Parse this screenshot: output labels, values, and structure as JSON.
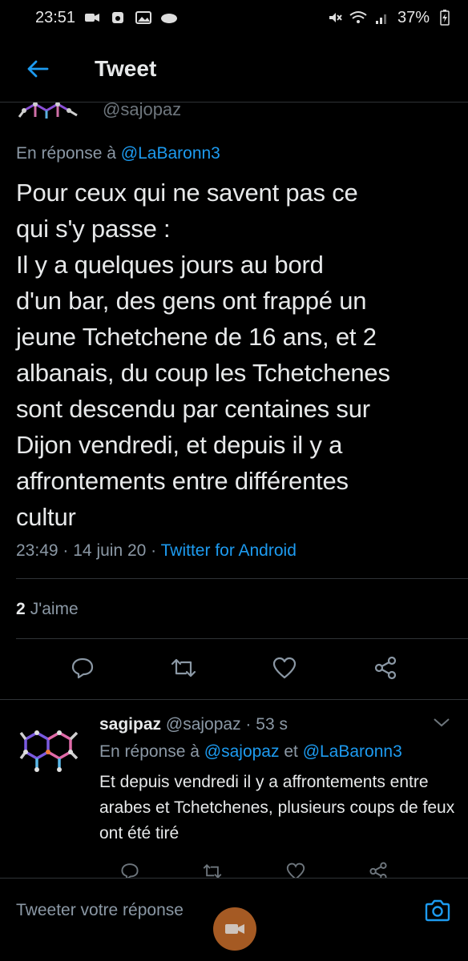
{
  "status_bar": {
    "time": "23:51",
    "battery": "37%"
  },
  "header": {
    "title": "Tweet"
  },
  "main_tweet": {
    "handle": "@sajopaz",
    "reply_prefix": "En réponse à",
    "reply_mention": "@LaBaronn3",
    "text": "Pour ceux qui ne savent pas ce\nqui s'y passe :\nIl y a quelques jours au bord\nd'un bar, des gens ont frappé un\njeune Tchetchene de 16 ans, et 2\nalbanais, du coup les Tchetchenes\nsont descendu par centaines sur\nDijon vendredi, et depuis il y a\naffrontements entre différentes\ncultur",
    "time": "23:49",
    "date": "14 juin 20",
    "separator": "·",
    "source": "Twitter for Android",
    "likes_count": "2",
    "likes_label": "J'aime"
  },
  "reply_tweet": {
    "name": "sagipaz",
    "handle": "@sajopaz",
    "age": "53 s",
    "separator": "·",
    "reply_prefix": "En réponse à",
    "mention_1": "@sajopaz",
    "conjunction": "et",
    "mention_2": "@LaBaronn3",
    "text": "Et depuis vendredi il y a affrontements entre arabes et Tchetchenes, plusieurs coups de feux ont été tiré"
  },
  "composer": {
    "placeholder": "Tweeter votre réponse"
  },
  "colors": {
    "accent": "#1d9bf0",
    "background": "#000000",
    "text": "#e7e9ea",
    "muted": "#8b98a5",
    "divider": "#2f3336"
  }
}
